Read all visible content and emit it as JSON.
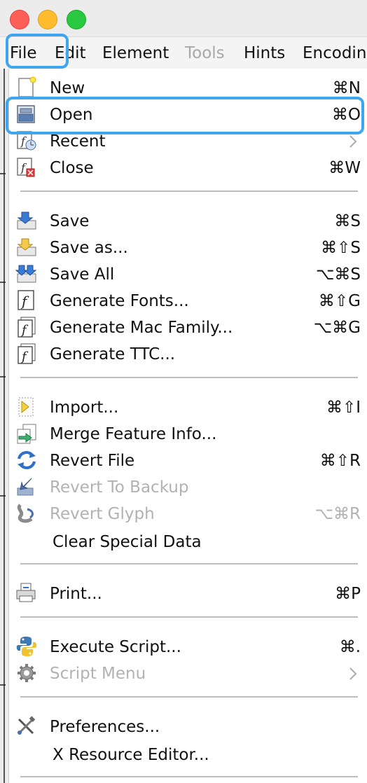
{
  "window": {
    "traffic_lights": [
      "close",
      "minimize",
      "zoom"
    ]
  },
  "menubar": {
    "items": [
      {
        "label": "File",
        "enabled": true
      },
      {
        "label": "Edit",
        "enabled": true
      },
      {
        "label": "Element",
        "enabled": true
      },
      {
        "label": "Tools",
        "enabled": false
      },
      {
        "label": "Hints",
        "enabled": true
      },
      {
        "label": "Encodin",
        "enabled": true
      }
    ]
  },
  "file_menu": {
    "items": [
      {
        "label": "New",
        "shortcut": "⌘N",
        "icon": "new-file-icon",
        "enabled": true
      },
      {
        "label": "Open",
        "shortcut": "⌘O",
        "icon": "open-file-icon",
        "enabled": true,
        "highlighted": true
      },
      {
        "label": "Recent",
        "shortcut": "",
        "icon": "recent-icon",
        "enabled": true,
        "submenu": true
      },
      {
        "label": "Close",
        "shortcut": "⌘W",
        "icon": "close-file-icon",
        "enabled": true
      },
      {
        "label": "Save",
        "shortcut": "⌘S",
        "icon": "save-icon",
        "enabled": true
      },
      {
        "label": "Save as...",
        "shortcut": "⌘⇧S",
        "icon": "save-as-icon",
        "enabled": true
      },
      {
        "label": "Save All",
        "shortcut": "⌥⌘S",
        "icon": "save-all-icon",
        "enabled": true
      },
      {
        "label": "Generate Fonts...",
        "shortcut": "⌘⇧G",
        "icon": "generate-fonts-icon",
        "enabled": true
      },
      {
        "label": "Generate Mac Family...",
        "shortcut": "⌥⌘G",
        "icon": "generate-mac-family-icon",
        "enabled": true
      },
      {
        "label": "Generate TTC...",
        "shortcut": "",
        "icon": "generate-ttc-icon",
        "enabled": true
      },
      {
        "label": "Import...",
        "shortcut": "⌘⇧I",
        "icon": "import-icon",
        "enabled": true
      },
      {
        "label": "Merge Feature Info...",
        "shortcut": "",
        "icon": "merge-feature-icon",
        "enabled": true
      },
      {
        "label": "Revert File",
        "shortcut": "⌘⇧R",
        "icon": "revert-file-icon",
        "enabled": true
      },
      {
        "label": "Revert To Backup",
        "shortcut": "",
        "icon": "revert-backup-icon",
        "enabled": false
      },
      {
        "label": "Revert Glyph",
        "shortcut": "⌥⌘R",
        "icon": "revert-glyph-icon",
        "enabled": false
      },
      {
        "label": "Clear Special Data",
        "shortcut": "",
        "icon": "",
        "enabled": true
      },
      {
        "label": "Print...",
        "shortcut": "⌘P",
        "icon": "print-icon",
        "enabled": true
      },
      {
        "label": "Execute Script...",
        "shortcut": "⌘.",
        "icon": "python-icon",
        "enabled": true
      },
      {
        "label": "Script Menu",
        "shortcut": "",
        "icon": "gear-icon",
        "enabled": false,
        "submenu": true
      },
      {
        "label": "Preferences...",
        "shortcut": "",
        "icon": "tools-icon",
        "enabled": true
      },
      {
        "label": "X Resource Editor...",
        "shortcut": "",
        "icon": "",
        "enabled": true
      }
    ]
  },
  "colors": {
    "highlight": "#3ea6ee",
    "disabled_text": "#b2b2b2",
    "separator": "#bdbdbd"
  }
}
